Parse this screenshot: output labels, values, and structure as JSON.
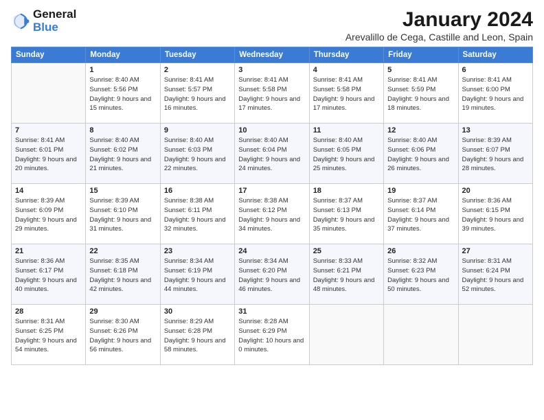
{
  "header": {
    "logo_line1": "General",
    "logo_line2": "Blue",
    "month_year": "January 2024",
    "location": "Arevalillo de Cega, Castille and Leon, Spain"
  },
  "days_of_week": [
    "Sunday",
    "Monday",
    "Tuesday",
    "Wednesday",
    "Thursday",
    "Friday",
    "Saturday"
  ],
  "weeks": [
    [
      {
        "day": "",
        "sunrise": "",
        "sunset": "",
        "daylight": ""
      },
      {
        "day": "1",
        "sunrise": "Sunrise: 8:40 AM",
        "sunset": "Sunset: 5:56 PM",
        "daylight": "Daylight: 9 hours and 15 minutes."
      },
      {
        "day": "2",
        "sunrise": "Sunrise: 8:41 AM",
        "sunset": "Sunset: 5:57 PM",
        "daylight": "Daylight: 9 hours and 16 minutes."
      },
      {
        "day": "3",
        "sunrise": "Sunrise: 8:41 AM",
        "sunset": "Sunset: 5:58 PM",
        "daylight": "Daylight: 9 hours and 17 minutes."
      },
      {
        "day": "4",
        "sunrise": "Sunrise: 8:41 AM",
        "sunset": "Sunset: 5:58 PM",
        "daylight": "Daylight: 9 hours and 17 minutes."
      },
      {
        "day": "5",
        "sunrise": "Sunrise: 8:41 AM",
        "sunset": "Sunset: 5:59 PM",
        "daylight": "Daylight: 9 hours and 18 minutes."
      },
      {
        "day": "6",
        "sunrise": "Sunrise: 8:41 AM",
        "sunset": "Sunset: 6:00 PM",
        "daylight": "Daylight: 9 hours and 19 minutes."
      }
    ],
    [
      {
        "day": "7",
        "sunrise": "Sunrise: 8:41 AM",
        "sunset": "Sunset: 6:01 PM",
        "daylight": "Daylight: 9 hours and 20 minutes."
      },
      {
        "day": "8",
        "sunrise": "Sunrise: 8:40 AM",
        "sunset": "Sunset: 6:02 PM",
        "daylight": "Daylight: 9 hours and 21 minutes."
      },
      {
        "day": "9",
        "sunrise": "Sunrise: 8:40 AM",
        "sunset": "Sunset: 6:03 PM",
        "daylight": "Daylight: 9 hours and 22 minutes."
      },
      {
        "day": "10",
        "sunrise": "Sunrise: 8:40 AM",
        "sunset": "Sunset: 6:04 PM",
        "daylight": "Daylight: 9 hours and 24 minutes."
      },
      {
        "day": "11",
        "sunrise": "Sunrise: 8:40 AM",
        "sunset": "Sunset: 6:05 PM",
        "daylight": "Daylight: 9 hours and 25 minutes."
      },
      {
        "day": "12",
        "sunrise": "Sunrise: 8:40 AM",
        "sunset": "Sunset: 6:06 PM",
        "daylight": "Daylight: 9 hours and 26 minutes."
      },
      {
        "day": "13",
        "sunrise": "Sunrise: 8:39 AM",
        "sunset": "Sunset: 6:07 PM",
        "daylight": "Daylight: 9 hours and 28 minutes."
      }
    ],
    [
      {
        "day": "14",
        "sunrise": "Sunrise: 8:39 AM",
        "sunset": "Sunset: 6:09 PM",
        "daylight": "Daylight: 9 hours and 29 minutes."
      },
      {
        "day": "15",
        "sunrise": "Sunrise: 8:39 AM",
        "sunset": "Sunset: 6:10 PM",
        "daylight": "Daylight: 9 hours and 31 minutes."
      },
      {
        "day": "16",
        "sunrise": "Sunrise: 8:38 AM",
        "sunset": "Sunset: 6:11 PM",
        "daylight": "Daylight: 9 hours and 32 minutes."
      },
      {
        "day": "17",
        "sunrise": "Sunrise: 8:38 AM",
        "sunset": "Sunset: 6:12 PM",
        "daylight": "Daylight: 9 hours and 34 minutes."
      },
      {
        "day": "18",
        "sunrise": "Sunrise: 8:37 AM",
        "sunset": "Sunset: 6:13 PM",
        "daylight": "Daylight: 9 hours and 35 minutes."
      },
      {
        "day": "19",
        "sunrise": "Sunrise: 8:37 AM",
        "sunset": "Sunset: 6:14 PM",
        "daylight": "Daylight: 9 hours and 37 minutes."
      },
      {
        "day": "20",
        "sunrise": "Sunrise: 8:36 AM",
        "sunset": "Sunset: 6:15 PM",
        "daylight": "Daylight: 9 hours and 39 minutes."
      }
    ],
    [
      {
        "day": "21",
        "sunrise": "Sunrise: 8:36 AM",
        "sunset": "Sunset: 6:17 PM",
        "daylight": "Daylight: 9 hours and 40 minutes."
      },
      {
        "day": "22",
        "sunrise": "Sunrise: 8:35 AM",
        "sunset": "Sunset: 6:18 PM",
        "daylight": "Daylight: 9 hours and 42 minutes."
      },
      {
        "day": "23",
        "sunrise": "Sunrise: 8:34 AM",
        "sunset": "Sunset: 6:19 PM",
        "daylight": "Daylight: 9 hours and 44 minutes."
      },
      {
        "day": "24",
        "sunrise": "Sunrise: 8:34 AM",
        "sunset": "Sunset: 6:20 PM",
        "daylight": "Daylight: 9 hours and 46 minutes."
      },
      {
        "day": "25",
        "sunrise": "Sunrise: 8:33 AM",
        "sunset": "Sunset: 6:21 PM",
        "daylight": "Daylight: 9 hours and 48 minutes."
      },
      {
        "day": "26",
        "sunrise": "Sunrise: 8:32 AM",
        "sunset": "Sunset: 6:23 PM",
        "daylight": "Daylight: 9 hours and 50 minutes."
      },
      {
        "day": "27",
        "sunrise": "Sunrise: 8:31 AM",
        "sunset": "Sunset: 6:24 PM",
        "daylight": "Daylight: 9 hours and 52 minutes."
      }
    ],
    [
      {
        "day": "28",
        "sunrise": "Sunrise: 8:31 AM",
        "sunset": "Sunset: 6:25 PM",
        "daylight": "Daylight: 9 hours and 54 minutes."
      },
      {
        "day": "29",
        "sunrise": "Sunrise: 8:30 AM",
        "sunset": "Sunset: 6:26 PM",
        "daylight": "Daylight: 9 hours and 56 minutes."
      },
      {
        "day": "30",
        "sunrise": "Sunrise: 8:29 AM",
        "sunset": "Sunset: 6:28 PM",
        "daylight": "Daylight: 9 hours and 58 minutes."
      },
      {
        "day": "31",
        "sunrise": "Sunrise: 8:28 AM",
        "sunset": "Sunset: 6:29 PM",
        "daylight": "Daylight: 10 hours and 0 minutes."
      },
      {
        "day": "",
        "sunrise": "",
        "sunset": "",
        "daylight": ""
      },
      {
        "day": "",
        "sunrise": "",
        "sunset": "",
        "daylight": ""
      },
      {
        "day": "",
        "sunrise": "",
        "sunset": "",
        "daylight": ""
      }
    ]
  ]
}
